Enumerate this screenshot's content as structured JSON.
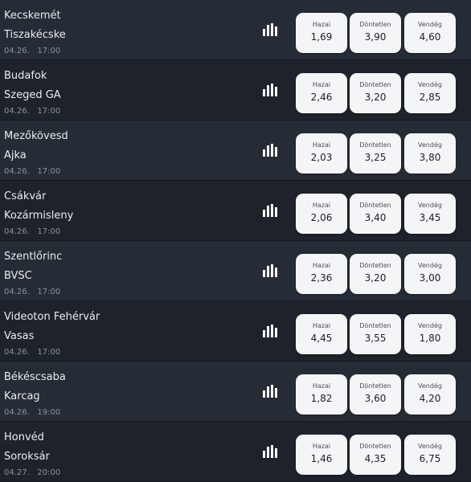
{
  "labels": {
    "home": "Hazai",
    "draw": "Döntetlen",
    "away": "Vendég"
  },
  "matches": [
    {
      "home": "Kecskemét",
      "away": "Tiszakécske",
      "date": "04.26.",
      "time": "17:00",
      "odds": {
        "home": "1,69",
        "draw": "3,90",
        "away": "4,60"
      }
    },
    {
      "home": "Budafok",
      "away": "Szeged GA",
      "date": "04.26.",
      "time": "17:00",
      "odds": {
        "home": "2,46",
        "draw": "3,20",
        "away": "2,85"
      }
    },
    {
      "home": "Mezőkövesd",
      "away": "Ajka",
      "date": "04.26.",
      "time": "17:00",
      "odds": {
        "home": "2,03",
        "draw": "3,25",
        "away": "3,80"
      }
    },
    {
      "home": "Csákvár",
      "away": "Kozármisleny",
      "date": "04.26.",
      "time": "17:00",
      "odds": {
        "home": "2,06",
        "draw": "3,40",
        "away": "3,45"
      }
    },
    {
      "home": "Szentlőrinc",
      "away": "BVSC",
      "date": "04.26.",
      "time": "17:00",
      "odds": {
        "home": "2,36",
        "draw": "3,20",
        "away": "3,00"
      }
    },
    {
      "home": "Videoton Fehérvár",
      "away": "Vasas",
      "date": "04.26.",
      "time": "17:00",
      "odds": {
        "home": "4,45",
        "draw": "3,55",
        "away": "1,80"
      }
    },
    {
      "home": "Békéscsaba",
      "away": "Karcag",
      "date": "04.26.",
      "time": "19:00",
      "odds": {
        "home": "1,82",
        "draw": "3,60",
        "away": "4,20"
      }
    },
    {
      "home": "Honvéd",
      "away": "Soroksár",
      "date": "04.27.",
      "time": "20:00",
      "odds": {
        "home": "1,46",
        "draw": "4,35",
        "away": "6,75"
      }
    }
  ],
  "icons": {
    "stats": "bar-chart-icon"
  },
  "colors": {
    "row_alt": "#262c35",
    "row_base": "#1e232b",
    "button": "#f4f5f7",
    "text": "#e9ecef",
    "muted": "#8a929c"
  }
}
